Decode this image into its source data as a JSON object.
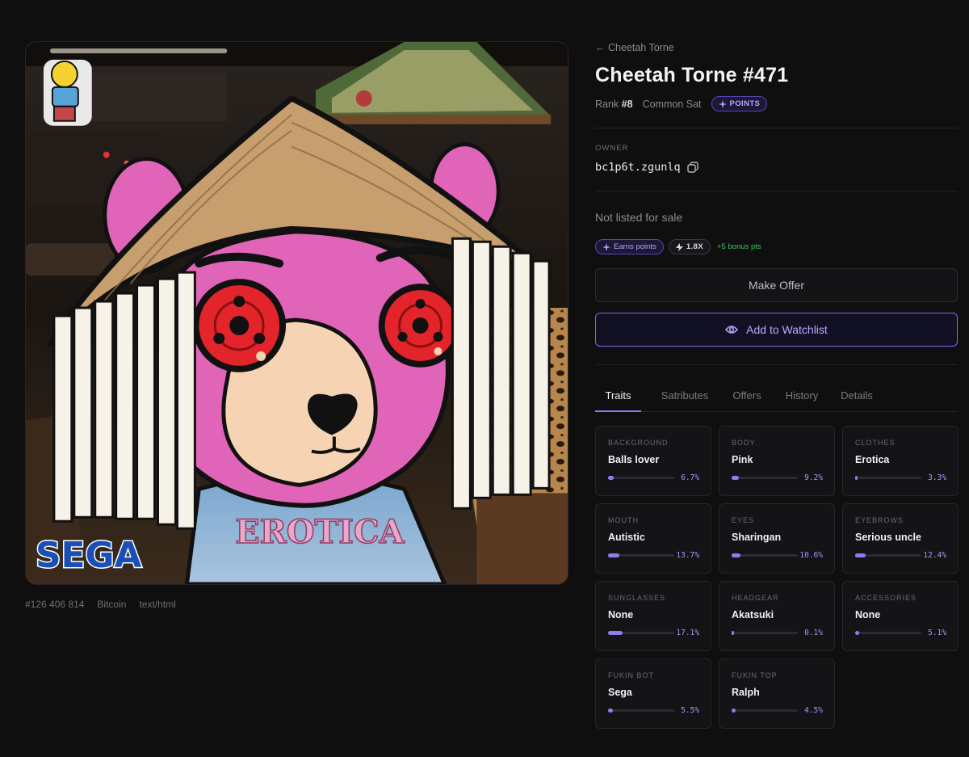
{
  "asset": {
    "meta": [
      "#126 406 814",
      "Bitcoin",
      "text/html"
    ],
    "art_text": {
      "shirt": "EROTICA",
      "logo": "SEGA"
    }
  },
  "header": {
    "back_label": "← Cheetah Torne",
    "title": "Cheetah Torne #471",
    "rank_label": "Rank",
    "rank_value": "#8",
    "sat_type": "Common Sat",
    "points_badge": "POINTS"
  },
  "owner": {
    "label": "OWNER",
    "address": "bc1p6t.zgunlq"
  },
  "listing": {
    "status": "Not listed for sale",
    "earns_points": "Earns points",
    "multiplier": "1.8X",
    "bonus": "+5 bonus pts"
  },
  "actions": {
    "make_offer": "Make Offer",
    "watchlist": "Add to Watchlist"
  },
  "tabs": [
    "Traits",
    "Satributes",
    "Offers",
    "History",
    "Details"
  ],
  "traits": [
    {
      "type": "BACKGROUND",
      "value": "Balls lover",
      "pct": "6.7%",
      "fraction": 0.067
    },
    {
      "type": "BODY",
      "value": "Pink",
      "pct": "9.2%",
      "fraction": 0.092
    },
    {
      "type": "CLOTHES",
      "value": "Erotica",
      "pct": "3.3%",
      "fraction": 0.033
    },
    {
      "type": "MOUTH",
      "value": "Autistic",
      "pct": "13.7%",
      "fraction": 0.137
    },
    {
      "type": "EYES",
      "value": "Sharingan",
      "pct": "10.6%",
      "fraction": 0.106
    },
    {
      "type": "EYEBROWS",
      "value": "Serious uncle",
      "pct": "12.4%",
      "fraction": 0.124
    },
    {
      "type": "SUNGLASSES",
      "value": "None",
      "pct": "17.1%",
      "fraction": 0.171
    },
    {
      "type": "HEADGEAR",
      "value": "Akatsuki",
      "pct": "0.1%",
      "fraction": 0.001
    },
    {
      "type": "ACCESSORIES",
      "value": "None",
      "pct": "5.1%",
      "fraction": 0.051
    },
    {
      "type": "FUKIN BOT",
      "value": "Sega",
      "pct": "5.5%",
      "fraction": 0.055
    },
    {
      "type": "FUKIN TOP",
      "value": "Ralph",
      "pct": "4.5%",
      "fraction": 0.045
    }
  ],
  "colors": {
    "accent": "#8e7cf3",
    "body_pink": "#e065b8",
    "hat": "#c79f6e",
    "eye_red": "#e3242b",
    "bonus_green": "#3ec66c"
  }
}
